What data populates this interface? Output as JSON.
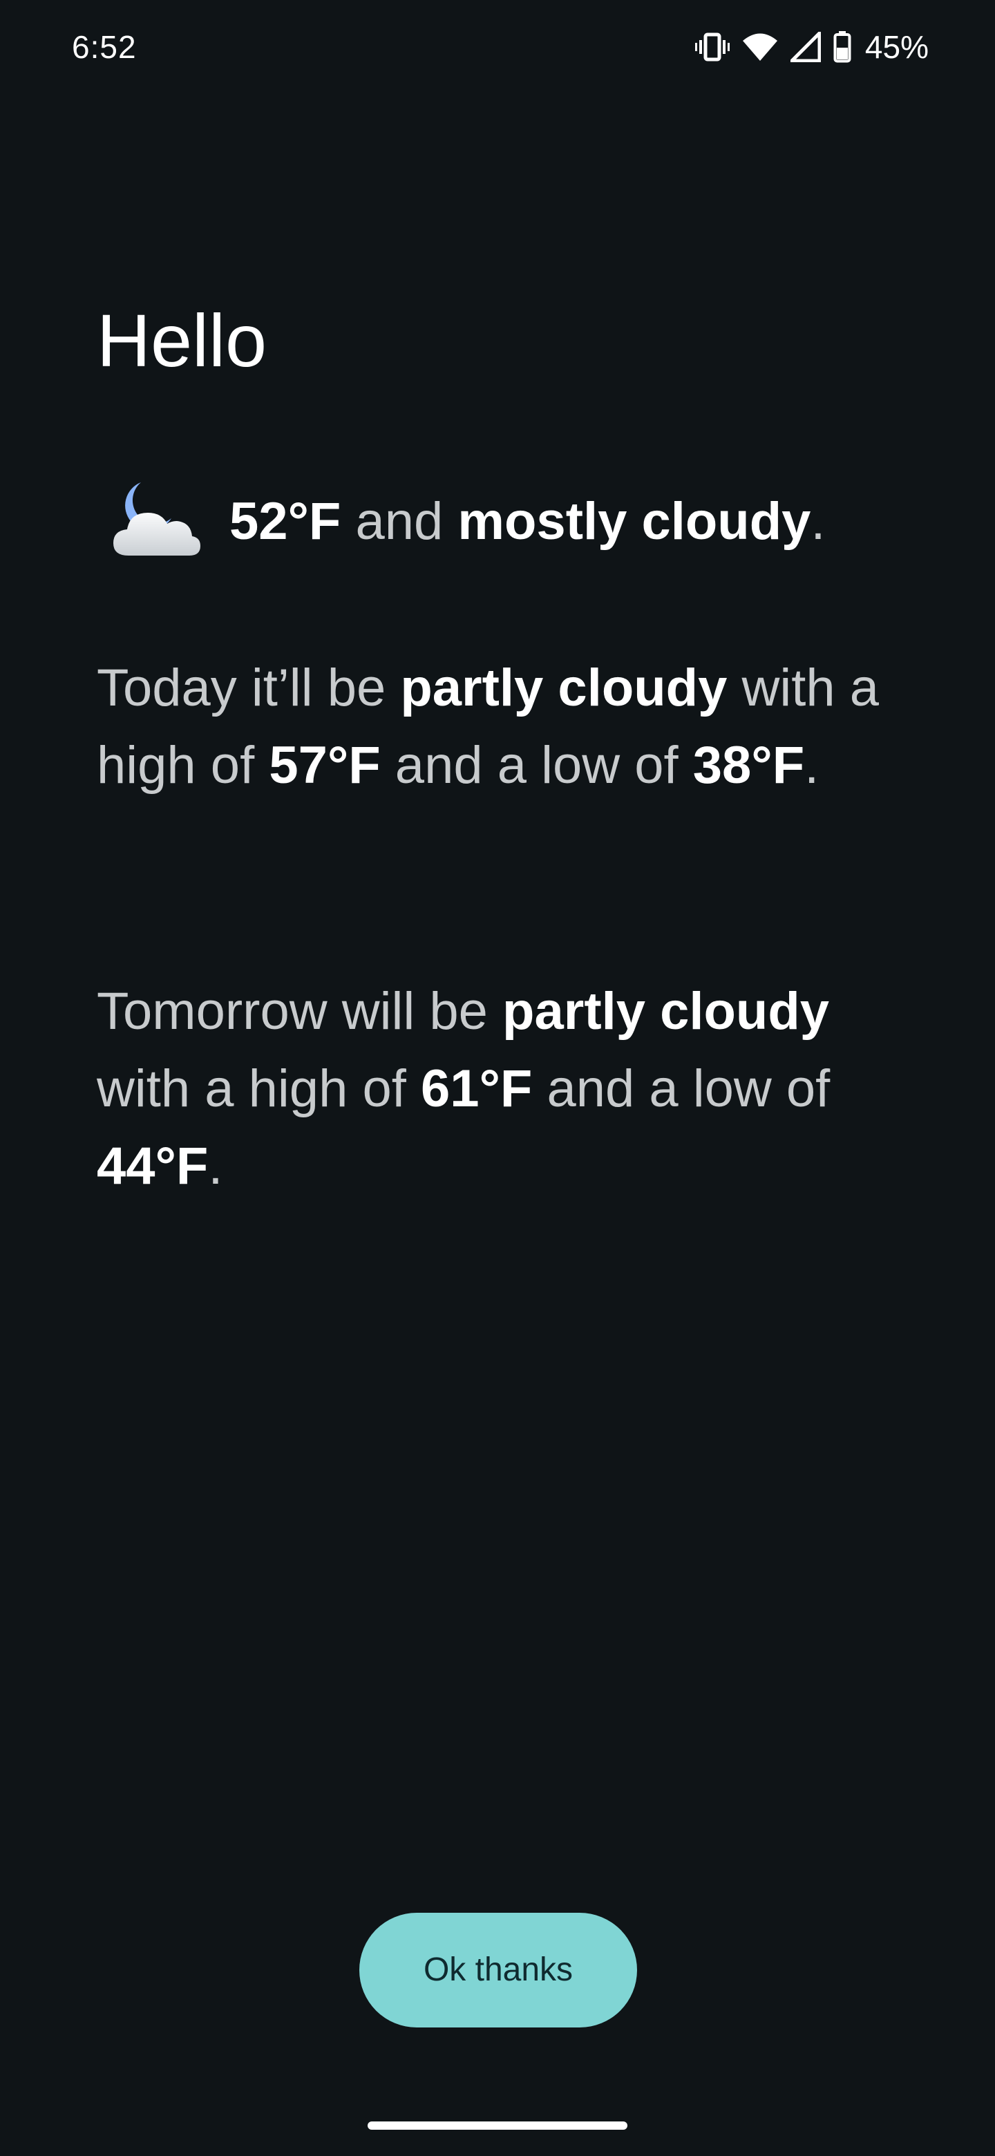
{
  "status_bar": {
    "time": "6:52",
    "battery_percent": "45%",
    "icons": [
      "vibrate-icon",
      "wifi-icon",
      "cell-signal-icon",
      "battery-icon"
    ]
  },
  "greeting": "Hello",
  "current": {
    "icon": "night-mostly-cloudy-icon",
    "temp": "52°F",
    "connector": "and",
    "condition": "mostly cloudy",
    "end": "."
  },
  "today": {
    "lead": "Today it’ll be",
    "condition": "partly cloudy",
    "mid1": "with a high of",
    "high": "57°F",
    "mid2": "and a low of",
    "low": "38°F",
    "end": "."
  },
  "tomorrow": {
    "lead": "Tomorrow will be",
    "condition": "partly cloudy",
    "mid1": "with a high of",
    "high": "61°F",
    "mid2": "and a low of",
    "low": "44°F",
    "end": "."
  },
  "button": {
    "label": "Ok thanks"
  },
  "colors": {
    "background": "#0f1417",
    "primary_text": "#ffffff",
    "secondary_text": "#c8cbcd",
    "button_bg": "#80d5d4",
    "button_text": "#0f2a2f",
    "moon": "#8ab4f8"
  }
}
